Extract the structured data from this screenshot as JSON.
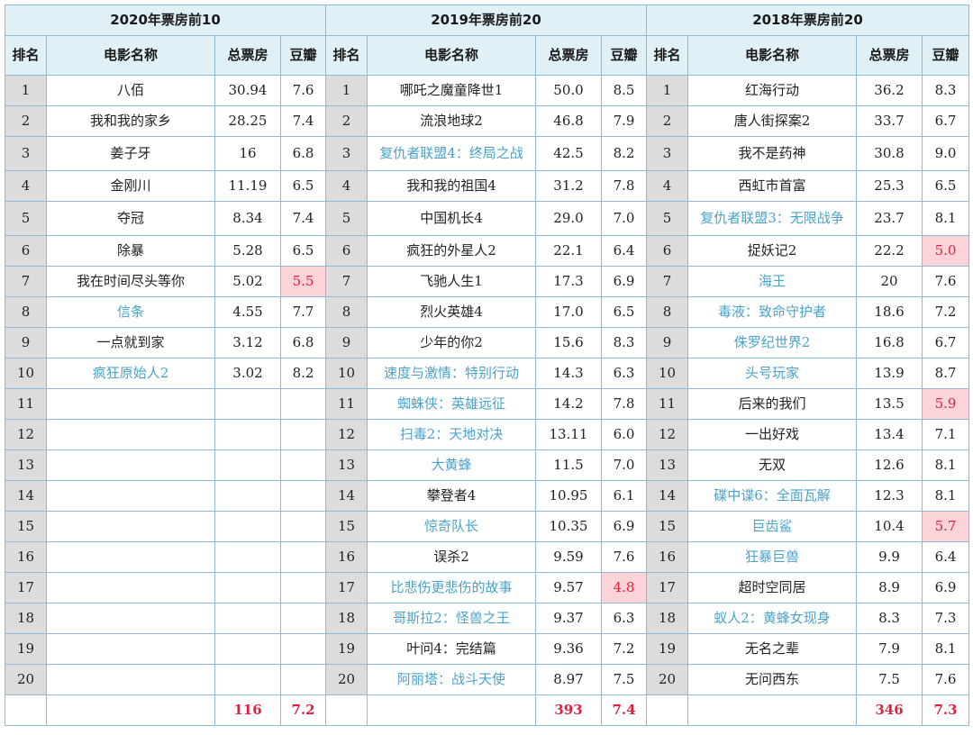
{
  "colors": {
    "header_bg": "#dff0f7",
    "rank_bg": "#dcdcdc",
    "border": "#8fb9d6",
    "link_title": "#4aa3c8",
    "low_score_bg": "#fbd3d9",
    "low_score_text": "#e0203c",
    "total_text": "#e0203c"
  },
  "headers": {
    "rank": "排名",
    "name": "电影名称",
    "box": "总票房",
    "score": "豆瓣"
  },
  "sections": [
    {
      "title": "2020年票房前10",
      "total_box": "116",
      "total_score": "7.2",
      "movies": [
        {
          "rank": "1",
          "name": "八佰",
          "box": "30.94",
          "score": "7.6",
          "hl": false,
          "low": false
        },
        {
          "rank": "2",
          "name": "我和我的家乡",
          "box": "28.25",
          "score": "7.4",
          "hl": false,
          "low": false
        },
        {
          "rank": "3",
          "name": "姜子牙",
          "box": "16",
          "score": "6.8",
          "hl": false,
          "low": false
        },
        {
          "rank": "4",
          "name": "金刚川",
          "box": "11.19",
          "score": "6.5",
          "hl": false,
          "low": false
        },
        {
          "rank": "5",
          "name": "夺冠",
          "box": "8.34",
          "score": "7.4",
          "hl": false,
          "low": false
        },
        {
          "rank": "6",
          "name": "除暴",
          "box": "5.28",
          "score": "6.5",
          "hl": false,
          "low": false
        },
        {
          "rank": "7",
          "name": "我在时间尽头等你",
          "box": "5.02",
          "score": "5.5",
          "hl": false,
          "low": true
        },
        {
          "rank": "8",
          "name": "信条",
          "box": "4.55",
          "score": "7.7",
          "hl": true,
          "low": false
        },
        {
          "rank": "9",
          "name": "一点就到家",
          "box": "3.12",
          "score": "6.8",
          "hl": false,
          "low": false
        },
        {
          "rank": "10",
          "name": "疯狂原始人2",
          "box": "3.02",
          "score": "8.2",
          "hl": true,
          "low": false
        },
        {
          "rank": "11",
          "name": "",
          "box": "",
          "score": "",
          "hl": false,
          "low": false
        },
        {
          "rank": "12",
          "name": "",
          "box": "",
          "score": "",
          "hl": false,
          "low": false
        },
        {
          "rank": "13",
          "name": "",
          "box": "",
          "score": "",
          "hl": false,
          "low": false
        },
        {
          "rank": "14",
          "name": "",
          "box": "",
          "score": "",
          "hl": false,
          "low": false
        },
        {
          "rank": "15",
          "name": "",
          "box": "",
          "score": "",
          "hl": false,
          "low": false
        },
        {
          "rank": "16",
          "name": "",
          "box": "",
          "score": "",
          "hl": false,
          "low": false
        },
        {
          "rank": "17",
          "name": "",
          "box": "",
          "score": "",
          "hl": false,
          "low": false
        },
        {
          "rank": "18",
          "name": "",
          "box": "",
          "score": "",
          "hl": false,
          "low": false
        },
        {
          "rank": "19",
          "name": "",
          "box": "",
          "score": "",
          "hl": false,
          "low": false
        },
        {
          "rank": "20",
          "name": "",
          "box": "",
          "score": "",
          "hl": false,
          "low": false
        }
      ]
    },
    {
      "title": "2019年票房前20",
      "total_box": "393",
      "total_score": "7.4",
      "movies": [
        {
          "rank": "1",
          "name": "哪吒之魔童降世1",
          "box": "50.0",
          "score": "8.5",
          "hl": false,
          "low": false
        },
        {
          "rank": "2",
          "name": "流浪地球2",
          "box": "46.8",
          "score": "7.9",
          "hl": false,
          "low": false
        },
        {
          "rank": "3",
          "name": "复仇者联盟4：终局之战",
          "box": "42.5",
          "score": "8.2",
          "hl": true,
          "low": false
        },
        {
          "rank": "4",
          "name": "我和我的祖国4",
          "box": "31.2",
          "score": "7.8",
          "hl": false,
          "low": false
        },
        {
          "rank": "5",
          "name": "中国机长4",
          "box": "29.0",
          "score": "7.0",
          "hl": false,
          "low": false
        },
        {
          "rank": "6",
          "name": "疯狂的外星人2",
          "box": "22.1",
          "score": "6.4",
          "hl": false,
          "low": false
        },
        {
          "rank": "7",
          "name": "飞驰人生1",
          "box": "17.3",
          "score": "6.9",
          "hl": false,
          "low": false
        },
        {
          "rank": "8",
          "name": "烈火英雄4",
          "box": "17.0",
          "score": "6.5",
          "hl": false,
          "low": false
        },
        {
          "rank": "9",
          "name": "少年的你2",
          "box": "15.6",
          "score": "8.3",
          "hl": false,
          "low": false
        },
        {
          "rank": "10",
          "name": "速度与激情：特别行动",
          "box": "14.3",
          "score": "6.3",
          "hl": true,
          "low": false
        },
        {
          "rank": "11",
          "name": "蜘蛛侠：英雄远征",
          "box": "14.2",
          "score": "7.8",
          "hl": true,
          "low": false
        },
        {
          "rank": "12",
          "name": "扫毒2：天地对决",
          "box": "13.11",
          "score": "6.0",
          "hl": true,
          "low": false
        },
        {
          "rank": "13",
          "name": "大黄蜂",
          "box": "11.5",
          "score": "7.0",
          "hl": true,
          "low": false
        },
        {
          "rank": "14",
          "name": "攀登者4",
          "box": "10.95",
          "score": "6.1",
          "hl": false,
          "low": false
        },
        {
          "rank": "15",
          "name": "惊奇队长",
          "box": "10.35",
          "score": "6.9",
          "hl": true,
          "low": false
        },
        {
          "rank": "16",
          "name": "误杀2",
          "box": "9.59",
          "score": "7.6",
          "hl": false,
          "low": false
        },
        {
          "rank": "17",
          "name": "比悲伤更悲伤的故事",
          "box": "9.57",
          "score": "4.8",
          "hl": true,
          "low": true
        },
        {
          "rank": "18",
          "name": "哥斯拉2：怪兽之王",
          "box": "9.37",
          "score": "6.3",
          "hl": true,
          "low": false
        },
        {
          "rank": "19",
          "name": "叶问4：完结篇",
          "box": "9.36",
          "score": "7.2",
          "hl": false,
          "low": false
        },
        {
          "rank": "20",
          "name": "阿丽塔：战斗天使",
          "box": "8.97",
          "score": "7.5",
          "hl": true,
          "low": false
        }
      ]
    },
    {
      "title": "2018年票房前20",
      "total_box": "346",
      "total_score": "7.3",
      "movies": [
        {
          "rank": "1",
          "name": "红海行动",
          "box": "36.2",
          "score": "8.3",
          "hl": false,
          "low": false
        },
        {
          "rank": "2",
          "name": "唐人街探案2",
          "box": "33.7",
          "score": "6.7",
          "hl": false,
          "low": false
        },
        {
          "rank": "3",
          "name": "我不是药神",
          "box": "30.8",
          "score": "9.0",
          "hl": false,
          "low": false
        },
        {
          "rank": "4",
          "name": "西虹市首富",
          "box": "25.3",
          "score": "6.5",
          "hl": false,
          "low": false
        },
        {
          "rank": "5",
          "name": "复仇者联盟3：无限战争",
          "box": "23.7",
          "score": "8.1",
          "hl": true,
          "low": false
        },
        {
          "rank": "6",
          "name": "捉妖记2",
          "box": "22.2",
          "score": "5.0",
          "hl": false,
          "low": true
        },
        {
          "rank": "7",
          "name": "海王",
          "box": "20",
          "score": "7.6",
          "hl": true,
          "low": false
        },
        {
          "rank": "8",
          "name": "毒液：致命守护者",
          "box": "18.6",
          "score": "7.2",
          "hl": true,
          "low": false
        },
        {
          "rank": "9",
          "name": "侏罗纪世界2",
          "box": "16.8",
          "score": "6.7",
          "hl": true,
          "low": false
        },
        {
          "rank": "10",
          "name": "头号玩家",
          "box": "13.9",
          "score": "8.7",
          "hl": true,
          "low": false
        },
        {
          "rank": "11",
          "name": "后来的我们",
          "box": "13.5",
          "score": "5.9",
          "hl": false,
          "low": true
        },
        {
          "rank": "12",
          "name": "一出好戏",
          "box": "13.4",
          "score": "7.1",
          "hl": false,
          "low": false
        },
        {
          "rank": "13",
          "name": "无双",
          "box": "12.6",
          "score": "8.1",
          "hl": false,
          "low": false
        },
        {
          "rank": "14",
          "name": "碟中谍6：全面瓦解",
          "box": "12.3",
          "score": "8.1",
          "hl": true,
          "low": false
        },
        {
          "rank": "15",
          "name": "巨齿鲨",
          "box": "10.4",
          "score": "5.7",
          "hl": true,
          "low": true
        },
        {
          "rank": "16",
          "name": "狂暴巨兽",
          "box": "9.9",
          "score": "6.4",
          "hl": true,
          "low": false
        },
        {
          "rank": "17",
          "name": "超时空同居",
          "box": "8.9",
          "score": "6.9",
          "hl": false,
          "low": false
        },
        {
          "rank": "18",
          "name": "蚁人2：黄蜂女现身",
          "box": "8.3",
          "score": "7.3",
          "hl": true,
          "low": false
        },
        {
          "rank": "19",
          "name": "无名之辈",
          "box": "7.9",
          "score": "8.1",
          "hl": false,
          "low": false
        },
        {
          "rank": "20",
          "name": "无问西东",
          "box": "7.5",
          "score": "7.6",
          "hl": false,
          "low": false
        }
      ]
    }
  ]
}
